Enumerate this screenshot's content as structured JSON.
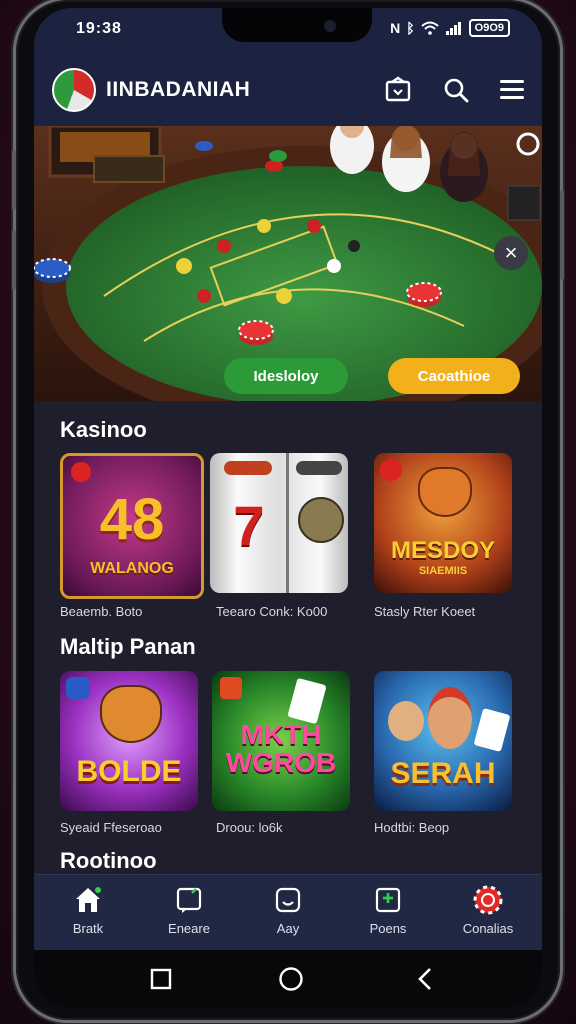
{
  "status": {
    "time": "19:38",
    "battery": "Ο9Ο9"
  },
  "header": {
    "brand": "IINBADANIAH"
  },
  "hero": {
    "btn_green": "Idesloloy",
    "btn_yellow": "Caoathioe"
  },
  "sections": {
    "s1_title": "Kasinoo",
    "s2_title": "Maltip Panan",
    "s3_title": "Rootinoo"
  },
  "row1": [
    {
      "art": "48",
      "sub": "WALANOG",
      "caption": "Beaemb. Boto"
    },
    {
      "art": "7",
      "sub": "",
      "caption": "Teearo Conk: Ko00"
    },
    {
      "art": "MESDOY",
      "sub": "SIAEMIIS",
      "caption": "Stasly Rter Koeet"
    }
  ],
  "row2": [
    {
      "art": "BOLDE",
      "caption": "Syeaid Ffeseroao"
    },
    {
      "art": "MKTH WGROB",
      "caption": "Droou: lo6k"
    },
    {
      "art": "SERAH",
      "caption": "Hodtbi: Beop"
    }
  ],
  "nav": [
    {
      "label": "Bratk",
      "icon": "home-icon"
    },
    {
      "label": "Eneare",
      "icon": "message-icon"
    },
    {
      "label": "Aay",
      "icon": "smile-icon"
    },
    {
      "label": "Poens",
      "icon": "add-box-icon"
    },
    {
      "label": "Conalias",
      "icon": "casino-chip-icon"
    }
  ],
  "colors": {
    "header": "#1b2340",
    "felt": "#2f7a34",
    "green_btn": "#2d9a38",
    "yellow_btn": "#f2b01a"
  }
}
